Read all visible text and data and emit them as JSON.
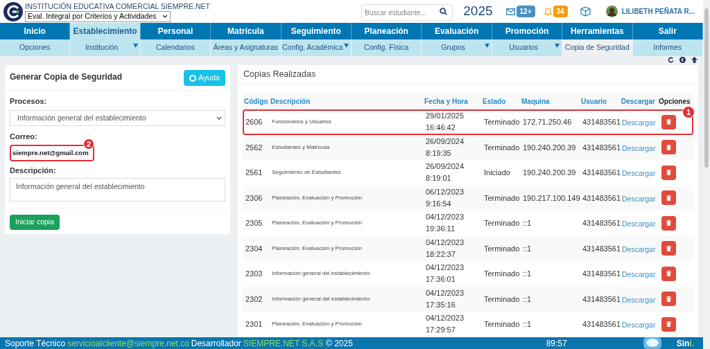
{
  "header": {
    "institution": "INSTITUCIÓN EDUCATIVA COMERCIAL SIEMPRE.NET",
    "mode_select": "Eval. Integral por Criterios y Actividades",
    "search": {
      "placeholder": "Buscar estudiante..."
    },
    "year": "2025",
    "messages_badge": "12+",
    "alerts_badge": "34",
    "user": "LILIBETH PEÑATA R..."
  },
  "menu": [
    {
      "label": "Inicio",
      "selected": false
    },
    {
      "label": "Establecimiento",
      "selected": true
    },
    {
      "label": "Personal",
      "selected": false
    },
    {
      "label": "Matrícula",
      "selected": false
    },
    {
      "label": "Seguimiento",
      "selected": false
    },
    {
      "label": "Planeación",
      "selected": false
    },
    {
      "label": "Evaluación",
      "selected": false
    },
    {
      "label": "Promoción",
      "selected": false
    },
    {
      "label": "Herramientas",
      "selected": false
    },
    {
      "label": "Salir",
      "selected": false
    }
  ],
  "submenu": [
    {
      "label": "Opciones",
      "selected": false,
      "dropdown": false
    },
    {
      "label": "Institución",
      "selected": false,
      "dropdown": true
    },
    {
      "label": "Calendarios",
      "selected": false,
      "dropdown": false
    },
    {
      "label": "Áreas y Asignaturas",
      "selected": false,
      "dropdown": false
    },
    {
      "label": "Config. Académica",
      "selected": false,
      "dropdown": true
    },
    {
      "label": "Config. Física",
      "selected": false,
      "dropdown": false
    },
    {
      "label": "Grupos",
      "selected": false,
      "dropdown": true
    },
    {
      "label": "Usuarios",
      "selected": false,
      "dropdown": true
    },
    {
      "label": "Copia de Seguridad",
      "selected": true,
      "dropdown": false
    },
    {
      "label": "Informes",
      "selected": false,
      "dropdown": false
    }
  ],
  "form": {
    "title": "Generar Copia de Seguridad",
    "help_button": "Ayuda",
    "process_label": "Procesos:",
    "process_value": "Información general del establecimiento",
    "email_label": "Correo:",
    "email_value": "siempre.net@gmail.com",
    "email_highlighted": true,
    "email_marker": "2",
    "description_label": "Descripción:",
    "description_value": "Información general del establecimiento",
    "submit_button": "Iniciar copia"
  },
  "table": {
    "title": "Copias Realizadas",
    "columns": [
      "Código",
      "Descripción",
      "Fecha y Hora",
      "Estado",
      "Maquina",
      "Usuario",
      "Descargar",
      "Opciones"
    ],
    "rows": [
      {
        "code": "2606",
        "description": "Funcionarios y Usuarios",
        "date": "29/01/2025",
        "time": "16:46:42",
        "status": "Terminado",
        "machine": "172.71.250.46",
        "user": "431483561",
        "download": "Descargar",
        "highlighted": true,
        "marker": "1"
      },
      {
        "code": "2562",
        "description": "Estudiantes y Matrícula",
        "date": "26/09/2024",
        "time": "8:19:35",
        "status": "Terminado",
        "machine": "190.240.200.39",
        "user": "431483561",
        "download": "Descargar",
        "highlighted": false
      },
      {
        "code": "2561",
        "description": "Seguimiento de Estudiantes",
        "date": "26/09/2024",
        "time": "8:19:01",
        "status": "Iniciado",
        "machine": "190.240.200.39",
        "user": "431483561",
        "download": "Descargar",
        "highlighted": false
      },
      {
        "code": "2306",
        "description": "Planeación, Evaluación y Promoción",
        "date": "06/12/2023",
        "time": "9:16:54",
        "status": "Terminado",
        "machine": "190.217.100.149",
        "user": "431483561",
        "download": "Descargar",
        "highlighted": false
      },
      {
        "code": "2305",
        "description": "Planeación, Evaluación y Promoción",
        "date": "04/12/2023",
        "time": "19:36:11",
        "status": "Terminado",
        "machine": "::1",
        "user": "431483561",
        "download": "Descargar",
        "highlighted": false
      },
      {
        "code": "2304",
        "description": "Planeación, Evaluación y Promoción",
        "date": "04/12/2023",
        "time": "18:22:37",
        "status": "Terminado",
        "machine": "::1",
        "user": "431483561",
        "download": "Descargar",
        "highlighted": false
      },
      {
        "code": "2303",
        "description": "Información general del establecimiento",
        "date": "04/12/2023",
        "time": "17:36:01",
        "status": "Terminado",
        "machine": "::1",
        "user": "431483561",
        "download": "Descargar",
        "highlighted": false
      },
      {
        "code": "2302",
        "description": "Información general del establecimiento",
        "date": "04/12/2023",
        "time": "17:35:16",
        "status": "Terminado",
        "machine": "::1",
        "user": "431483561",
        "download": "Descargar",
        "highlighted": false
      },
      {
        "code": "2301",
        "description": "Planeación, Evaluación y Promoción",
        "date": "04/12/2023",
        "time": "17:29:57",
        "status": "Terminado",
        "machine": "::1",
        "user": "431483561",
        "download": "Descargar",
        "highlighted": false
      }
    ]
  },
  "footer": {
    "support_label": "Soporte Técnico",
    "support_email": "servicioalcliente@siempre.net.co",
    "developer_label": "Desarrollador",
    "developer": "SIEMPRE.NET S.A.S",
    "copyright": "© 2025",
    "timer": "89:57",
    "brand": "Sin",
    "brand_end": "i."
  }
}
